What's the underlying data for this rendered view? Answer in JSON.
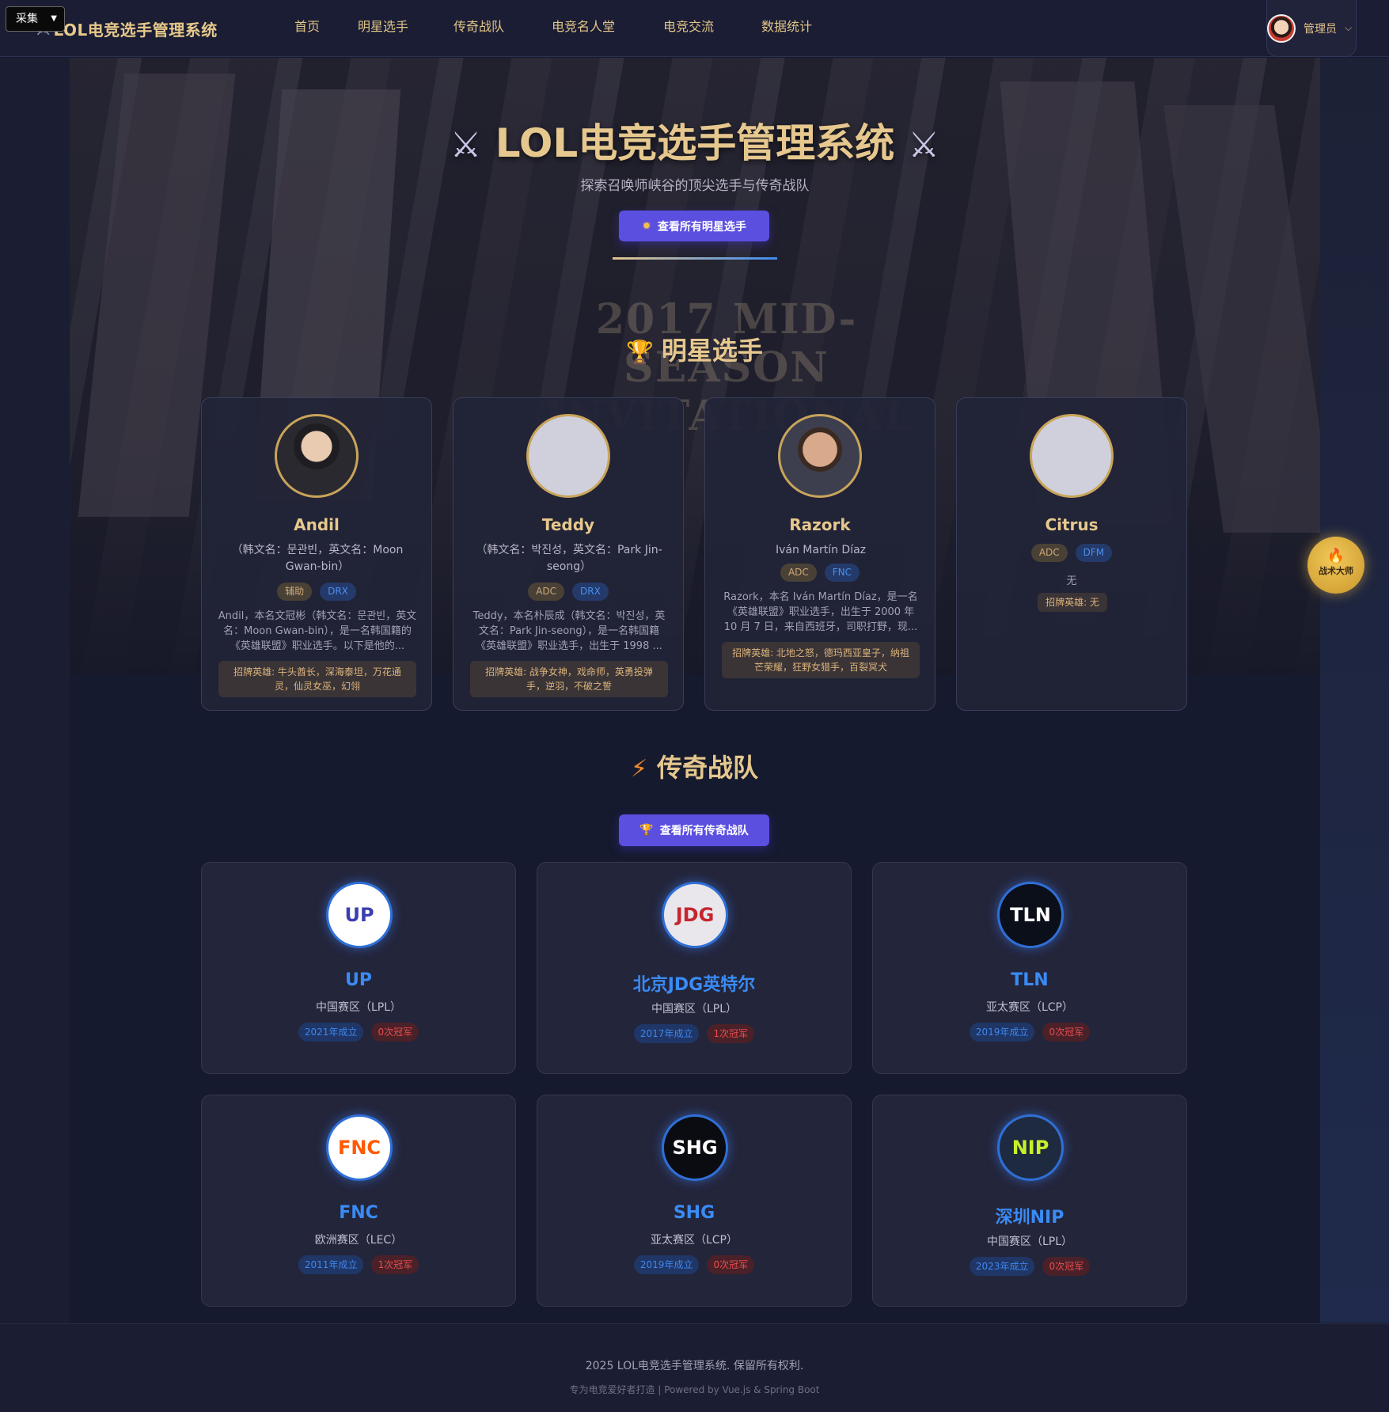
{
  "collect": {
    "label": "采集"
  },
  "brand": {
    "title": "LOL电竞选手管理系统"
  },
  "nav": {
    "items": [
      {
        "label": "首页"
      },
      {
        "label": "明星选手"
      },
      {
        "label": "传奇战队"
      },
      {
        "label": "电竞名人堂"
      },
      {
        "label": "电竞交流"
      },
      {
        "label": "数据统计"
      }
    ]
  },
  "user": {
    "name": "管理员"
  },
  "hero": {
    "title": "LOL电竞选手管理系统",
    "subtitle": "探索召唤师峡谷的顶尖选手与传奇战队",
    "button": "查看所有明星选手",
    "background_text": "2017 MID-SEASON INVITATIONAL"
  },
  "stars_section": {
    "title": "明星选手"
  },
  "players": [
    {
      "name": "Andil",
      "alias": "（韩文名：문관빈，英文名：Moon Gwan-bin）",
      "role": "辅助",
      "team": "DRX",
      "desc": "Andil，本名文冠彬（韩文名：문관빈，英文名：Moon Gwan-bin），是一名韩国籍的《英雄联盟》职业选手。以下是他的...",
      "heroes": "招牌英雄: 牛头酋长，深海泰坦，万花通灵，仙灵女巫，幻翎"
    },
    {
      "name": "Teddy",
      "alias": "（韩文名：박진성，英文名：Park Jin-seong）",
      "role": "ADC",
      "team": "DRX",
      "desc": "Teddy，本名朴辰成（韩文名：박진성，英文名：Park Jin-seong），是一名韩国籍《英雄联盟》职业选手，出生于 1998 ...",
      "heroes": "招牌英雄: 战争女神，戏命师，英勇投弹手，逆羽，不破之誓"
    },
    {
      "name": "Razork",
      "alias": "Iván Martín Díaz",
      "role": "ADC",
      "team": "FNC",
      "desc": "Razork，本名 Iván Martín Díaz，是一名《英雄联盟》职业选手，出生于 2000 年 10 月 7 日，来自西班牙，司职打野，现...",
      "heroes": "招牌英雄: 北地之怒，德玛西亚皇子，纳祖芒荣耀，狂野女猎手，百裂冥犬"
    },
    {
      "name": "Citrus",
      "role": "ADC",
      "team": "DFM",
      "desc": "无",
      "heroes": "招牌英雄: 无"
    }
  ],
  "teams_section": {
    "title": "传奇战队",
    "button": "查看所有传奇战队"
  },
  "teams": [
    {
      "logo": "UP",
      "name": "UP",
      "region": "中国赛区（LPL）",
      "founded": "2021年成立",
      "titles": "0次冠军",
      "logo_bg": "#ffffff",
      "logo_color": "#3b3fb0"
    },
    {
      "logo": "JDG",
      "name": "北京JDG英特尔",
      "region": "中国赛区（LPL）",
      "founded": "2017年成立",
      "titles": "1次冠军",
      "logo_bg": "#e9e6ec",
      "logo_color": "#c4262e"
    },
    {
      "logo": "TLN",
      "name": "TLN",
      "region": "亚太赛区（LCP）",
      "founded": "2019年成立",
      "titles": "0次冠军",
      "logo_bg": "#0b0f1a",
      "logo_color": "#ffffff"
    },
    {
      "logo": "FNC",
      "name": "FNC",
      "region": "欧洲赛区（LEC）",
      "founded": "2011年成立",
      "titles": "1次冠军",
      "logo_bg": "#ffffff",
      "logo_color": "#ff5a00"
    },
    {
      "logo": "SHG",
      "name": "SHG",
      "region": "亚太赛区（LCP）",
      "founded": "2019年成立",
      "titles": "0次冠军",
      "logo_bg": "#0b0c12",
      "logo_color": "#ffffff"
    },
    {
      "logo": "NIP",
      "name": "深圳NIP",
      "region": "中国赛区（LPL）",
      "founded": "2023年成立",
      "titles": "0次冠军",
      "logo_bg": "#1e2a40",
      "logo_color": "#c7f02a"
    }
  ],
  "float": {
    "label": "战术大师"
  },
  "footer": {
    "copyright": "2025 LOL电竞选手管理系统. 保留所有权利.",
    "powered": "专为电竞爱好者打造 | Powered by Vue.js & Spring Boot"
  }
}
